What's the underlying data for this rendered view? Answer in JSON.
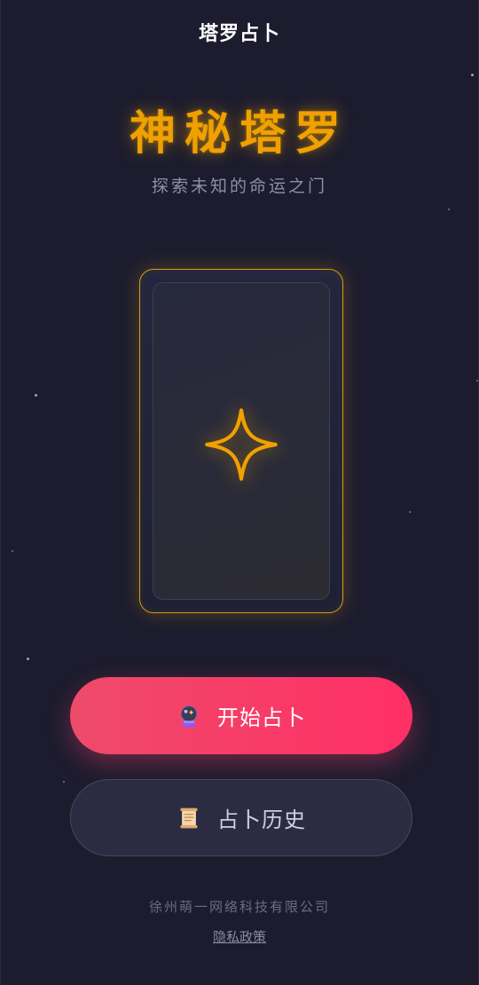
{
  "nav": {
    "title": "塔罗占卜"
  },
  "hero": {
    "title": "神秘塔罗",
    "subtitle": "探索未知的命运之门"
  },
  "card": {
    "icon": "four-point-star-icon"
  },
  "buttons": {
    "start": {
      "label": "开始占卜",
      "icon": "crystal-ball-icon"
    },
    "history": {
      "label": "占卜历史",
      "icon": "scroll-icon"
    }
  },
  "footer": {
    "company": "徐州萌一网络科技有限公司",
    "privacy": "隐私政策"
  },
  "colors": {
    "background": "#1c1c2e",
    "accent_gold": "#f0a100",
    "start_button_from": "#ee4b6a",
    "start_button_to": "#ff2f66",
    "history_button": "#2b2c42"
  }
}
